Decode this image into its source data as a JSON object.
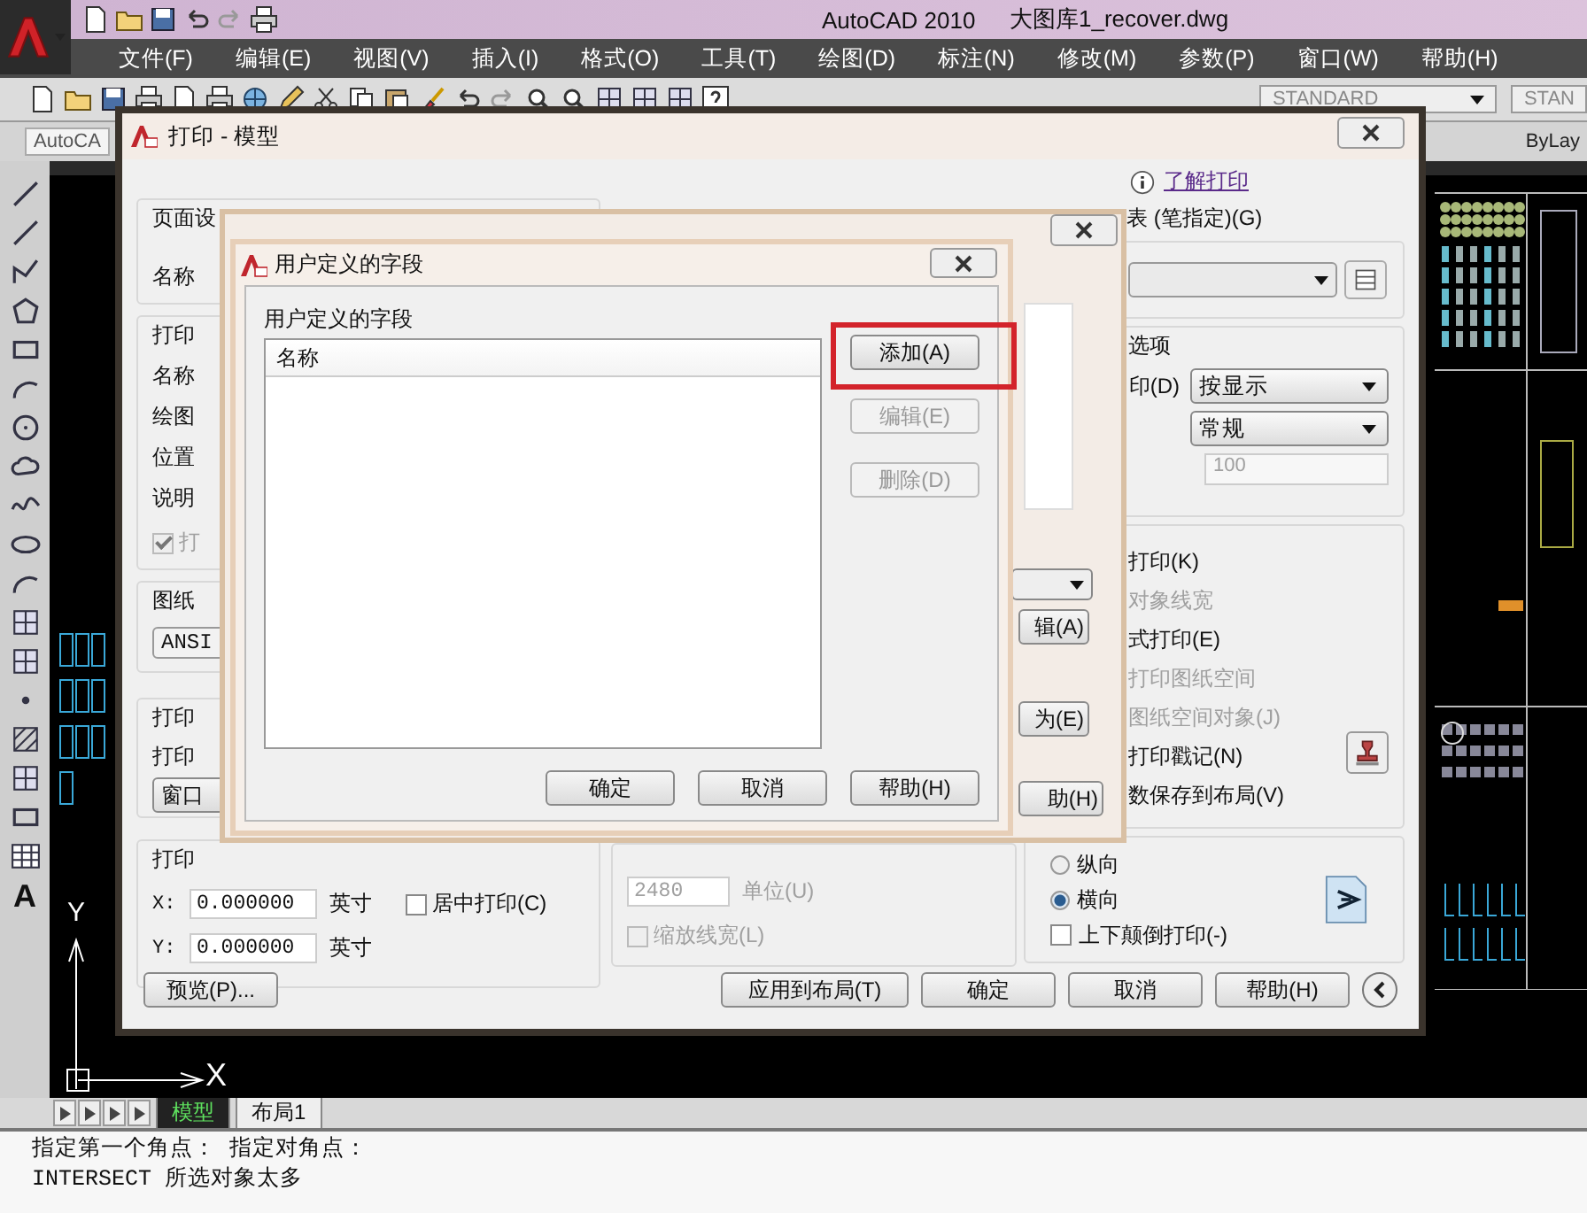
{
  "app": {
    "title": "AutoCAD 2010",
    "file": "大图库1_recover.dwg"
  },
  "menu": [
    "文件(F)",
    "编辑(E)",
    "视图(V)",
    "插入(I)",
    "格式(O)",
    "工具(T)",
    "绘图(D)",
    "标注(N)",
    "修改(M)",
    "参数(P)",
    "窗口(W)",
    "帮助(H)"
  ],
  "toolbar": {
    "style_combo": "STANDARD",
    "style_combo_2": "STAN"
  },
  "toolbar_2": {
    "layer_field": "AutoCA",
    "linetype_field": "ByLay"
  },
  "draw_toolbar": {
    "text_tool": "A"
  },
  "ucs": {
    "x_label": "X",
    "y_label": "Y"
  },
  "print_dialog": {
    "title": "打印 - 模型",
    "help_link": "了解打印",
    "page_setup": {
      "label": "页面设",
      "name_label": "名称"
    },
    "printer": {
      "label": "打印",
      "name_label": "名称",
      "plotter_label": "绘图",
      "where_label": "位置",
      "description_label": "说明",
      "to_file": {
        "label": "打",
        "checked": true,
        "disabled": true
      }
    },
    "paper": {
      "label": "图纸",
      "value": "ANSI"
    },
    "area": {
      "label": "打印",
      "what_label": "打印",
      "window_button": "窗口"
    },
    "offset": {
      "label": "打印",
      "x_label": "X:",
      "x_value": "0.000000",
      "x_unit": "英寸",
      "y_label": "Y:",
      "y_value": "0.000000",
      "y_unit": "英寸",
      "center": {
        "label": "居中打印(C)",
        "checked": false
      }
    },
    "scale": {
      "pixels": "2480",
      "pixels_disabled": true,
      "unit_label": "单位(U)",
      "lineweights": {
        "label": "缩放线宽(L)",
        "checked": false,
        "disabled": true
      }
    },
    "style_table": {
      "label": "表 (笔指定)(G)"
    },
    "viewport": {
      "label": "选项",
      "shade_label": "印(D)",
      "shade_value": "按显示",
      "quality_value": "常规",
      "dpi_value": "100",
      "dpi_disabled": true
    },
    "options": [
      {
        "label": "打印(K)",
        "disabled": false
      },
      {
        "label": "对象线宽",
        "disabled": true
      },
      {
        "label": "式打印(E)",
        "disabled": false
      },
      {
        "label": "打印图纸空间",
        "disabled": true
      },
      {
        "label": "图纸空间对象(J)",
        "disabled": true
      },
      {
        "label": "打印戳记(N)",
        "disabled": false
      },
      {
        "label": "数保存到布局(V)",
        "disabled": false
      }
    ],
    "orientation": [
      {
        "label": "纵向",
        "selected": false
      },
      {
        "label": "横向",
        "selected": true
      }
    ],
    "upside_down": {
      "label": "上下颠倒打印(-)",
      "checked": false
    },
    "buttons": {
      "preview": "预览(P)...",
      "apply": "应用到布局(T)",
      "ok": "确定",
      "cancel": "取消",
      "help": "帮助(H)"
    }
  },
  "stamp_dialog": {
    "buttons": [
      "辑(A)",
      "为(E)",
      "助(H)"
    ]
  },
  "fields_dialog": {
    "title": "用户定义的字段",
    "group_label": "用户定义的字段",
    "column": "名称",
    "side_buttons": [
      {
        "label": "添加(A)",
        "disabled": false,
        "highlighted": true
      },
      {
        "label": "编辑(E)",
        "disabled": true,
        "highlighted": false
      },
      {
        "label": "删除(D)",
        "disabled": true,
        "highlighted": false
      }
    ],
    "buttons": [
      "确定",
      "取消",
      "帮助(H)"
    ]
  },
  "layout_tabs": [
    {
      "label": "模型",
      "selected": true
    },
    {
      "label": "布局1",
      "selected": false
    }
  ],
  "command_lines": [
    "指定第一个角点： 指定对角点：",
    "INTERSECT 所选对象太多"
  ]
}
